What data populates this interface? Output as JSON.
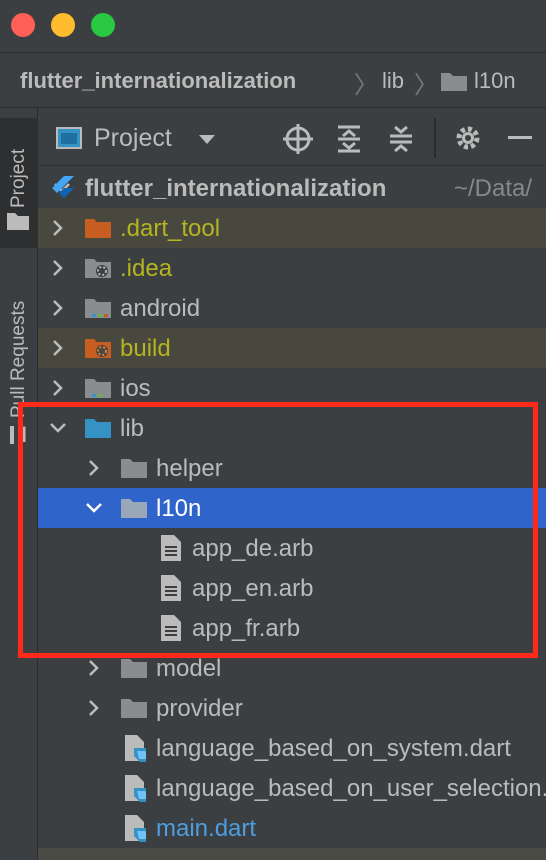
{
  "colors": {
    "accent_blue": "#2f65ca",
    "excluded_bg": "#49483f",
    "highlight_red": "#ff2a1a",
    "folder_gray": "#8a8d90",
    "folder_teal": "#3592c4",
    "folder_orange": "#c75d20",
    "excluded_text": "#b5b420",
    "dart_link": "#4d9de0"
  },
  "breadcrumb": {
    "project": "flutter_internationalization",
    "lib": "lib",
    "l10n": "l10n"
  },
  "sidebar": {
    "project_tab": "Project",
    "pull_requests_tab": "Pull Requests"
  },
  "toolbar": {
    "view_label": "Project"
  },
  "tree": {
    "root_name": "flutter_internationalization",
    "root_path": "~/Data/",
    "items": [
      {
        "label": ".dart_tool",
        "kind": "folder-excluded"
      },
      {
        "label": ".idea",
        "kind": "folder-config"
      },
      {
        "label": "android",
        "kind": "folder-module"
      },
      {
        "label": "build",
        "kind": "folder-excluded"
      },
      {
        "label": "ios",
        "kind": "folder-module"
      },
      {
        "label": "lib",
        "kind": "folder-source",
        "expanded": true
      },
      {
        "label": "helper",
        "kind": "folder"
      },
      {
        "label": "l10n",
        "kind": "folder",
        "expanded": true,
        "selected": true
      },
      {
        "label": "app_de.arb",
        "kind": "file"
      },
      {
        "label": "app_en.arb",
        "kind": "file"
      },
      {
        "label": "app_fr.arb",
        "kind": "file"
      },
      {
        "label": "model",
        "kind": "folder"
      },
      {
        "label": "provider",
        "kind": "folder"
      },
      {
        "label": "language_based_on_system.dart",
        "kind": "dart"
      },
      {
        "label": "language_based_on_user_selection.dart",
        "kind": "dart"
      },
      {
        "label": "main.dart",
        "kind": "dart"
      }
    ]
  }
}
